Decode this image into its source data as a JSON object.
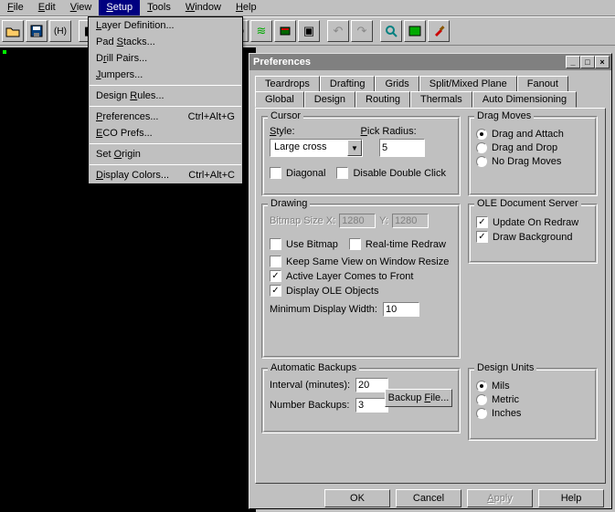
{
  "menubar": [
    "File",
    "Edit",
    "View",
    "Setup",
    "Tools",
    "Window",
    "Help"
  ],
  "menubar_active": 3,
  "toolbar_doc_label": "(H)",
  "dropdown": {
    "items": [
      {
        "label": "Layer Definition..."
      },
      {
        "label": "Pad Stacks..."
      },
      {
        "label": "Drill Pairs..."
      },
      {
        "label": "Jumpers..."
      },
      {
        "sep": true
      },
      {
        "label": "Design Rules..."
      },
      {
        "sep": true
      },
      {
        "label": "Preferences...",
        "shortcut": "Ctrl+Alt+G"
      },
      {
        "label": "ECO Prefs..."
      },
      {
        "sep": true
      },
      {
        "label": "Set Origin"
      },
      {
        "sep": true
      },
      {
        "label": "Display Colors...",
        "shortcut": "Ctrl+Alt+C"
      }
    ]
  },
  "dialog": {
    "title": "Preferences",
    "tabs_row1": [
      "Teardrops",
      "Drafting",
      "Grids",
      "Split/Mixed Plane",
      "Fanout"
    ],
    "tabs_row2": [
      "Global",
      "Design",
      "Routing",
      "Thermals",
      "Auto Dimensioning"
    ],
    "active_tab": "Global",
    "cursor": {
      "title": "Cursor",
      "style_label": "Style:",
      "style_value": "Large cross",
      "pick_label": "Pick Radius:",
      "pick_value": "5",
      "diagonal": "Diagonal",
      "disable_dbl": "Disable Double Click"
    },
    "drag": {
      "title": "Drag Moves",
      "opts": [
        "Drag and Attach",
        "Drag and Drop",
        "No Drag Moves"
      ],
      "selected": 0
    },
    "drawing": {
      "title": "Drawing",
      "bitmap_x_label": "Bitmap Size  X:",
      "bitmap_x": "1280",
      "bitmap_y_label": "Y:",
      "bitmap_y": "1280",
      "use_bitmap": "Use Bitmap",
      "realtime": "Real-time Redraw",
      "keep_view": "Keep Same View on Window Resize",
      "active_layer": "Active Layer Comes to Front",
      "display_ole": "Display OLE Objects",
      "min_width_label": "Minimum Display Width:",
      "min_width": "10"
    },
    "ole": {
      "title": "OLE Document Server",
      "update": "Update On Redraw",
      "draw_bg": "Draw Background"
    },
    "backups": {
      "title": "Automatic Backups",
      "interval_label": "Interval (minutes):",
      "interval": "20",
      "number_label": "Number Backups:",
      "number": "3",
      "backup_btn": "Backup File..."
    },
    "units": {
      "title": "Design Units",
      "opts": [
        "Mils",
        "Metric",
        "Inches"
      ],
      "selected": 0
    },
    "buttons": {
      "ok": "OK",
      "cancel": "Cancel",
      "apply": "Apply",
      "help": "Help"
    }
  }
}
